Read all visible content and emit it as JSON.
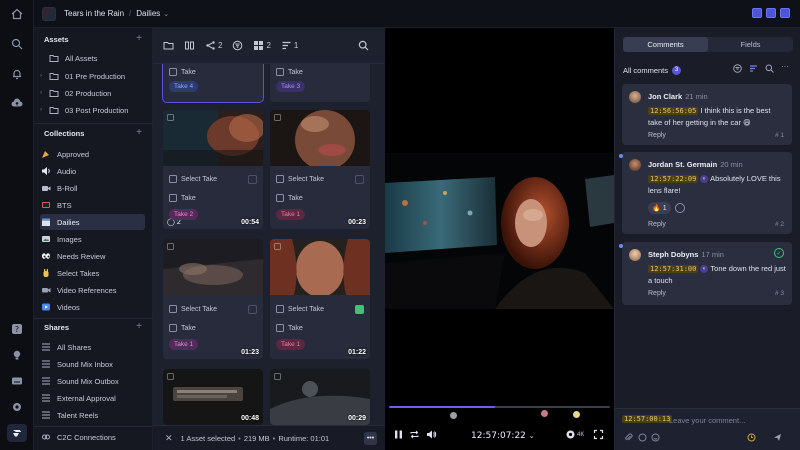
{
  "colors": {
    "accent": "#5b54d9",
    "timecode_bg": "#4a3f18",
    "resolved": "#3ec47a"
  },
  "rail": {
    "icons": [
      "home-icon",
      "search-icon",
      "bell-icon",
      "cloud-upload-icon",
      "help-icon",
      "lightbulb-icon",
      "keyboard-icon",
      "settings-icon",
      "frameio-logo"
    ]
  },
  "topbar": {
    "project": "Tears in the Rain",
    "separator": "/",
    "current": "Dailies",
    "chevron": "⌄"
  },
  "sidebar": {
    "assets_heading": "Assets",
    "assets": [
      {
        "label": "All Assets"
      },
      {
        "label": "01 Pre Production"
      },
      {
        "label": "02 Production"
      },
      {
        "label": "03 Post Production"
      }
    ],
    "collections_heading": "Collections",
    "collections": [
      {
        "label": "Approved"
      },
      {
        "label": "Audio"
      },
      {
        "label": "B-Roll"
      },
      {
        "label": "BTS"
      },
      {
        "label": "Dailies"
      },
      {
        "label": "Images"
      },
      {
        "label": "Needs Review"
      },
      {
        "label": "Select Takes"
      },
      {
        "label": "Video References"
      },
      {
        "label": "Videos"
      }
    ],
    "shares_heading": "Shares",
    "shares": [
      {
        "label": "All Shares"
      },
      {
        "label": "Sound Mix Inbox"
      },
      {
        "label": "Sound Mix Outbox"
      },
      {
        "label": "External Approval"
      },
      {
        "label": "Talent Reels"
      }
    ],
    "c2c": "C2C Connections",
    "add_symbol": "+"
  },
  "asset_toolbar": {
    "group_count": "2",
    "grid_count": "2",
    "list_count": "1"
  },
  "cards": [
    {
      "has_thumb": false,
      "take": "Take",
      "tag": "Take 4",
      "tag_style": "blue",
      "selected": true
    },
    {
      "has_thumb": false,
      "take": "Take",
      "tag": "Take 3",
      "tag_style": "violet",
      "selected": false
    },
    {
      "has_thumb": true,
      "duration": "00:54",
      "comments": "2",
      "select": "Select Take",
      "select_checked": false,
      "take": "Take",
      "tag": "Take 2",
      "tag_style": "pinkv"
    },
    {
      "has_thumb": true,
      "duration": "00:23",
      "select": "Select Take",
      "select_checked": false,
      "take": "Take",
      "tag": "Take 1",
      "tag_style": "pink"
    },
    {
      "has_thumb": true,
      "duration": "01:23",
      "select": "Select Take",
      "select_checked": false,
      "take": "Take",
      "tag": "Take 1",
      "tag_style": "pinkv"
    },
    {
      "has_thumb": true,
      "duration": "01:22",
      "select": "Select Take",
      "select_checked": true,
      "take": "Take",
      "tag": "Take 1",
      "tag_style": "pink"
    },
    {
      "has_thumb": true,
      "duration": "00:48"
    },
    {
      "has_thumb": true,
      "duration": "00:29"
    }
  ],
  "asset_footer": {
    "selected": "1 Asset selected",
    "bullet": "•",
    "size": "219 MB",
    "runtime": "Runtime: 01:01",
    "more": "•••"
  },
  "player": {
    "timecode": "12:57:07:22",
    "tc_chevron": "⌄",
    "quality": "4K",
    "progress": 0.48
  },
  "comments_panel": {
    "tabs": [
      "Comments",
      "Fields"
    ],
    "heading": "All comments",
    "count": "3",
    "items": [
      {
        "name": "Jon Clark",
        "ago": "21 min",
        "timecode": "12:56:56:05",
        "text": "I think this is the best take of her getting in the car 😄",
        "reply": "Reply",
        "num": "# 1"
      },
      {
        "name": "Jordan St. Germain",
        "ago": "20 min",
        "timecode": "12:57:22:09",
        "text": "Absolutely LOVE this lens flare!",
        "reaction_emoji": "🔥",
        "reaction_count": "1",
        "reply": "Reply",
        "num": "# 2"
      },
      {
        "name": "Steph Dobyns",
        "ago": "17 min",
        "timecode": "12:57:31:00",
        "text": "Tone down the red just a touch",
        "reply": "Reply",
        "num": "# 3",
        "resolved_mark": "✓"
      }
    ],
    "composer_timecode": "12:57:00:13",
    "composer_placeholder": "Leave your comment..."
  }
}
